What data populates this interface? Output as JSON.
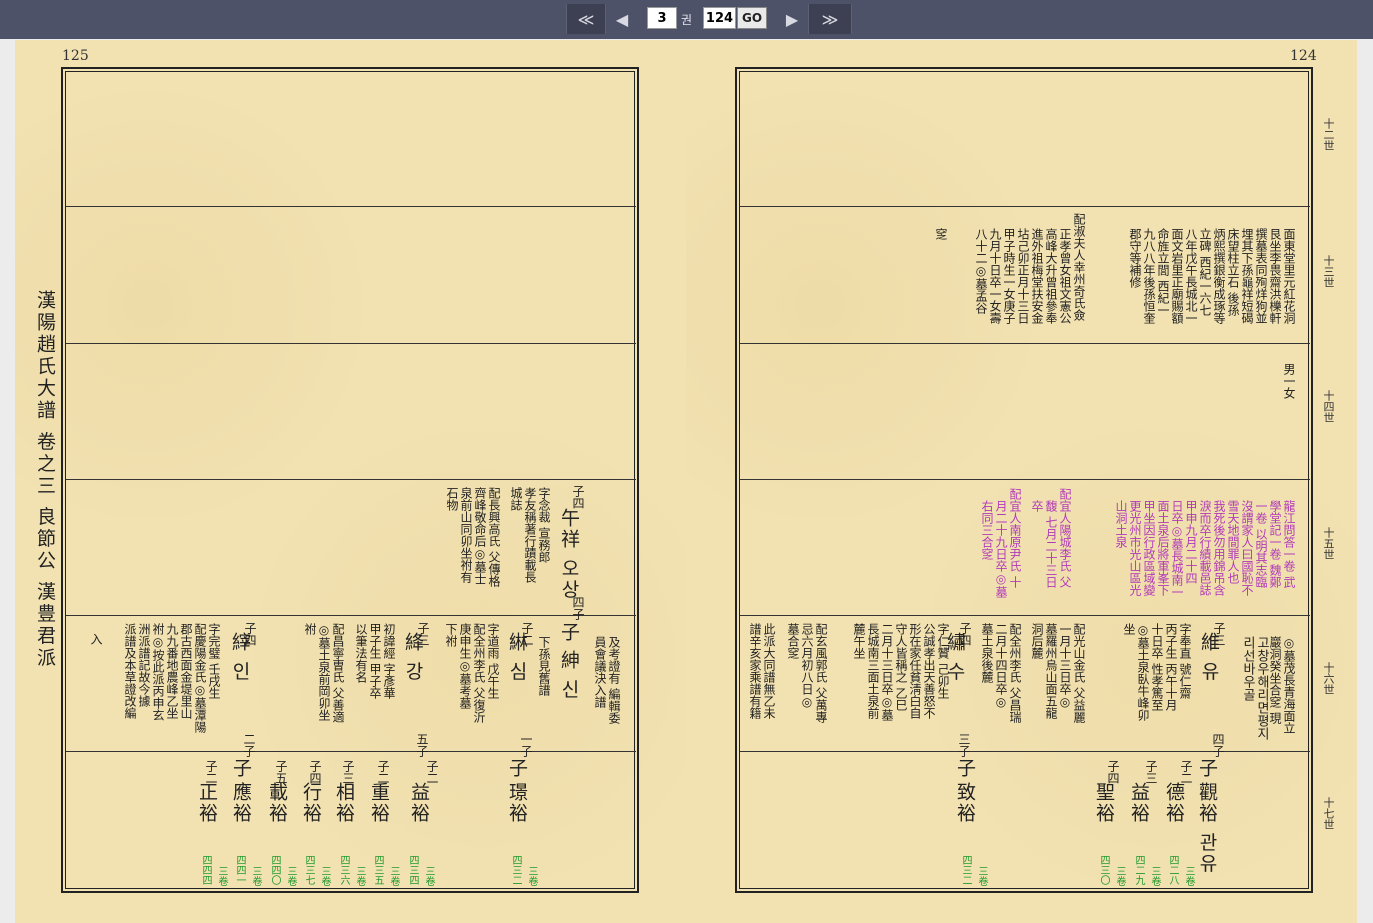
{
  "toolbar": {
    "first": "≪",
    "prev": "◀",
    "next": "▶",
    "last": "≫",
    "volume_value": "3",
    "volume_unit": "권",
    "page_value": "124",
    "go_label": "GO"
  },
  "left_page": {
    "page_number": "125",
    "side_title": "漢陽趙氏大譜 卷之三 良節公 漢豊君派",
    "cols": [
      {
        "id": "l_a1",
        "text": "子四",
        "cls": "t-sm"
      },
      {
        "id": "l_a2",
        "text": "午祥 오상",
        "cls": "t-nm"
      },
      {
        "id": "l_a3",
        "text": "四子",
        "cls": "t-sm"
      },
      {
        "id": "l_a4",
        "text": "字念裁 宣務郎",
        "cls": "t-sm"
      },
      {
        "id": "l_a5",
        "text": "孝友稱著行蹟載長",
        "cls": "t-sm"
      },
      {
        "id": "l_a6",
        "text": "城誌",
        "cls": "t-sm"
      },
      {
        "id": "l_a7",
        "text": "配長興高氏 父傳格",
        "cls": "t-sm"
      },
      {
        "id": "l_a8",
        "text": "齊峰敬命后◎墓士",
        "cls": "t-sm"
      },
      {
        "id": "l_a9",
        "text": "泉前山同卯坐祔有",
        "cls": "t-sm"
      },
      {
        "id": "l_a10",
        "text": "石物",
        "cls": "t-sm"
      },
      {
        "id": "l_b1",
        "text": "及考證有 編輯委",
        "cls": "t-sm"
      },
      {
        "id": "l_b2",
        "text": "員會議決入譜",
        "cls": "t-sm"
      },
      {
        "id": "l_b3",
        "text": "子",
        "cls": "t-nm"
      },
      {
        "id": "l_b4",
        "text": "紳 신",
        "cls": "t-nm"
      },
      {
        "id": "l_b5",
        "text": "下孫見舊譜",
        "cls": "t-sm"
      },
      {
        "id": "l_b6",
        "text": "子二",
        "cls": "t-sm"
      },
      {
        "id": "l_b7",
        "text": "綝 심",
        "cls": "t-nm"
      },
      {
        "id": "l_b8",
        "text": "一子",
        "cls": "t-sm"
      },
      {
        "id": "l_b9",
        "text": "字道雨 戊午生",
        "cls": "t-sm"
      },
      {
        "id": "l_b10",
        "text": "配全州李氏 父復沂",
        "cls": "t-sm"
      },
      {
        "id": "l_b11",
        "text": "庚申生◎墓考墓",
        "cls": "t-sm"
      },
      {
        "id": "l_b12",
        "text": "下祔",
        "cls": "t-sm"
      },
      {
        "id": "l_b13",
        "text": "子三",
        "cls": "t-sm"
      },
      {
        "id": "l_b14",
        "text": "絳 강",
        "cls": "t-nm"
      },
      {
        "id": "l_b15",
        "text": "五子",
        "cls": "t-sm"
      },
      {
        "id": "l_b16",
        "text": "初諱經 字彥華",
        "cls": "t-sm"
      },
      {
        "id": "l_b17",
        "text": "甲子生 甲子卒",
        "cls": "t-sm"
      },
      {
        "id": "l_b18",
        "text": "以筆法有名",
        "cls": "t-sm"
      },
      {
        "id": "l_b19",
        "text": "配昌寧曺氏 父善適",
        "cls": "t-sm"
      },
      {
        "id": "l_b20",
        "text": "◎墓土泉前岡卯坐",
        "cls": "t-sm"
      },
      {
        "id": "l_b21",
        "text": "祔",
        "cls": "t-sm"
      },
      {
        "id": "l_b22",
        "text": "子四",
        "cls": "t-sm"
      },
      {
        "id": "l_b23",
        "text": "縡 인",
        "cls": "t-nm"
      },
      {
        "id": "l_b24",
        "text": "二子",
        "cls": "t-sm"
      },
      {
        "id": "l_b25",
        "text": "字完璧 壬戌生",
        "cls": "t-sm"
      },
      {
        "id": "l_b26",
        "text": "配慶陽金氏◎墓潭陽",
        "cls": "t-sm"
      },
      {
        "id": "l_b27",
        "text": "郡古西面金堤里山",
        "cls": "t-sm"
      },
      {
        "id": "l_b28",
        "text": "九九番地農峰乙坐",
        "cls": "t-sm"
      },
      {
        "id": "l_b29",
        "text": "祔◎按此派丙申玄",
        "cls": "t-sm"
      },
      {
        "id": "l_b30",
        "text": "洲派譜記故今據",
        "cls": "t-sm"
      },
      {
        "id": "l_b31",
        "text": "派譜及本草證改編",
        "cls": "t-sm"
      },
      {
        "id": "l_b32",
        "text": "入",
        "cls": "t-sm"
      },
      {
        "id": "l_c1",
        "text": "子",
        "cls": "t-nm"
      },
      {
        "id": "l_c2",
        "text": "璟裕",
        "cls": "t-nm"
      },
      {
        "id": "l_c3",
        "text": "子二",
        "cls": "t-sm"
      },
      {
        "id": "l_c4",
        "text": "益裕",
        "cls": "t-nm"
      },
      {
        "id": "l_c5",
        "text": "子二",
        "cls": "t-sm"
      },
      {
        "id": "l_c6",
        "text": "重裕",
        "cls": "t-nm"
      },
      {
        "id": "l_c7",
        "text": "子三",
        "cls": "t-sm"
      },
      {
        "id": "l_c8",
        "text": "相裕",
        "cls": "t-nm"
      },
      {
        "id": "l_c9",
        "text": "子四",
        "cls": "t-sm"
      },
      {
        "id": "l_c10",
        "text": "行裕",
        "cls": "t-nm"
      },
      {
        "id": "l_c11",
        "text": "子五",
        "cls": "t-sm"
      },
      {
        "id": "l_c12",
        "text": "載裕",
        "cls": "t-nm"
      },
      {
        "id": "l_c13",
        "text": "子",
        "cls": "t-nm"
      },
      {
        "id": "l_c14",
        "text": "應裕",
        "cls": "t-nm"
      },
      {
        "id": "l_c15",
        "text": "子二",
        "cls": "t-sm"
      },
      {
        "id": "l_c16",
        "text": "正裕",
        "cls": "t-nm"
      },
      {
        "id": "l_g1",
        "text": "三卷",
        "cls": "t-gr"
      },
      {
        "id": "l_g2",
        "text": "四三二",
        "cls": "t-gr"
      },
      {
        "id": "l_g3",
        "text": "三卷",
        "cls": "t-gr"
      },
      {
        "id": "l_g4",
        "text": "四三四",
        "cls": "t-gr"
      },
      {
        "id": "l_g5",
        "text": "三卷",
        "cls": "t-gr"
      },
      {
        "id": "l_g6",
        "text": "四三五",
        "cls": "t-gr"
      },
      {
        "id": "l_g7",
        "text": "三卷",
        "cls": "t-gr"
      },
      {
        "id": "l_g8",
        "text": "四三六",
        "cls": "t-gr"
      },
      {
        "id": "l_g9",
        "text": "三卷",
        "cls": "t-gr"
      },
      {
        "id": "l_g10",
        "text": "四三七",
        "cls": "t-gr"
      },
      {
        "id": "l_g11",
        "text": "三卷",
        "cls": "t-gr"
      },
      {
        "id": "l_g12",
        "text": "四四〇",
        "cls": "t-gr"
      },
      {
        "id": "l_g13",
        "text": "三卷",
        "cls": "t-gr"
      },
      {
        "id": "l_g14",
        "text": "四四一",
        "cls": "t-gr"
      },
      {
        "id": "l_g15",
        "text": "三卷",
        "cls": "t-gr"
      },
      {
        "id": "l_g16",
        "text": "四四四",
        "cls": "t-gr"
      }
    ]
  },
  "right_page": {
    "page_number": "124",
    "generations": [
      "十二世",
      "十三世",
      "十四世",
      "十五世",
      "十六世",
      "十七世"
    ],
    "cols": [
      {
        "id": "r_a1",
        "text": "面東堂里元紅花洞",
        "cls": "t-sm"
      },
      {
        "id": "r_a2",
        "text": "艮坐李畏齋洪櫟軒",
        "cls": "t-sm"
      },
      {
        "id": "r_a3",
        "text": "撰墓表同殉烊狗並",
        "cls": "t-sm"
      },
      {
        "id": "r_a4",
        "text": "埋其下孫龜祥短碣",
        "cls": "t-sm"
      },
      {
        "id": "r_a5",
        "text": "床望柱立石 後孫",
        "cls": "t-sm"
      },
      {
        "id": "r_a6",
        "text": "炳熙撰銀衡成琢等",
        "cls": "t-sm"
      },
      {
        "id": "r_a7",
        "text": "立碑 西紀一六七",
        "cls": "t-sm"
      },
      {
        "id": "r_a8",
        "text": "八年戊午長城北一",
        "cls": "t-sm"
      },
      {
        "id": "r_a9",
        "text": "面文岩里正廟賜額",
        "cls": "t-sm"
      },
      {
        "id": "r_a10",
        "text": "命旌立閭 西紀一",
        "cls": "t-sm"
      },
      {
        "id": "r_a11",
        "text": "九八八年後孫恒奎",
        "cls": "t-sm"
      },
      {
        "id": "r_a12",
        "text": "郡守等補修",
        "cls": "t-sm"
      },
      {
        "id": "r_a13",
        "text": "配淑夫人幸州奇氏僉",
        "cls": "t-sm"
      },
      {
        "id": "r_a14",
        "text": "正孝曾女祖文憲公",
        "cls": "t-sm"
      },
      {
        "id": "r_a15",
        "text": "高峰大升曾祖參奉",
        "cls": "t-sm"
      },
      {
        "id": "r_a16",
        "text": "進外祖梅堂扶安金",
        "cls": "t-sm"
      },
      {
        "id": "r_a17",
        "text": "坫己卯正月十三日",
        "cls": "t-sm"
      },
      {
        "id": "r_a18",
        "text": "甲子時生一女庚子",
        "cls": "t-sm"
      },
      {
        "id": "r_a19",
        "text": "九月十日卒一女壽",
        "cls": "t-sm"
      },
      {
        "id": "r_a20",
        "text": "八十二◎墓孟谷",
        "cls": "t-sm"
      },
      {
        "id": "r_a21",
        "text": "窆",
        "cls": "t-sm"
      },
      {
        "id": "r_b1",
        "text": "男一女",
        "cls": "t-sm"
      },
      {
        "id": "r_c1",
        "text": "龍江問答一卷 武",
        "cls": "t-pk"
      },
      {
        "id": "r_c2",
        "text": "學堂記一卷 魏鄭",
        "cls": "t-pk"
      },
      {
        "id": "r_c3",
        "text": "一卷 以明其志臨",
        "cls": "t-pk"
      },
      {
        "id": "r_c4",
        "text": "沒謂家人曰國恥不",
        "cls": "t-pk"
      },
      {
        "id": "r_c5",
        "text": "雪天地間罪人也",
        "cls": "t-pk"
      },
      {
        "id": "r_c6",
        "text": "我死後勿用錦吊含",
        "cls": "t-pk"
      },
      {
        "id": "r_c7",
        "text": "淚而卒行績載邑誌",
        "cls": "t-pk"
      },
      {
        "id": "r_c8",
        "text": "甲申九月二十四",
        "cls": "t-pk"
      },
      {
        "id": "r_c9",
        "text": "日卒◎墓長城南一",
        "cls": "t-pk"
      },
      {
        "id": "r_c10",
        "text": "面土泉后將軍峯下",
        "cls": "t-pk"
      },
      {
        "id": "r_c11",
        "text": "甲坐因行政區域變",
        "cls": "t-pk"
      },
      {
        "id": "r_c12",
        "text": "更光州市光山區光",
        "cls": "t-pk"
      },
      {
        "id": "r_c13",
        "text": "山洞土泉",
        "cls": "t-pk"
      },
      {
        "id": "r_c14",
        "text": "配宜人陽城李氏 父",
        "cls": "t-pk"
      },
      {
        "id": "r_c15",
        "text": "馥 七月二十三日",
        "cls": "t-pk"
      },
      {
        "id": "r_c16",
        "text": "卒",
        "cls": "t-pk"
      },
      {
        "id": "r_c17",
        "text": "配宜人南原尹氏 十",
        "cls": "t-pk"
      },
      {
        "id": "r_c18",
        "text": "月二十九日卒◎墓",
        "cls": "t-pk"
      },
      {
        "id": "r_c19",
        "text": "右同三合窆",
        "cls": "t-pk"
      },
      {
        "id": "r_d1",
        "text": "◎墓茂長青海面立",
        "cls": "t-sm"
      },
      {
        "id": "r_d2",
        "text": "巖洞癸坐合窆 現",
        "cls": "t-sm"
      },
      {
        "id": "r_d3",
        "text": "고창우해리면평지",
        "cls": "t-ko"
      },
      {
        "id": "r_d4",
        "text": "리선바우골",
        "cls": "t-ko"
      },
      {
        "id": "r_d5",
        "text": "子三",
        "cls": "t-sm"
      },
      {
        "id": "r_d6",
        "text": "維 유",
        "cls": "t-nm"
      },
      {
        "id": "r_d7",
        "text": "四子",
        "cls": "t-sm"
      },
      {
        "id": "r_d8",
        "text": "字奉直 號仁齋",
        "cls": "t-sm"
      },
      {
        "id": "r_d9",
        "text": "丙子生 丙午十月",
        "cls": "t-sm"
      },
      {
        "id": "r_d10",
        "text": "十日卒 性孝篤至",
        "cls": "t-sm"
      },
      {
        "id": "r_d11",
        "text": "◎墓土泉臥牛峰卯",
        "cls": "t-sm"
      },
      {
        "id": "r_d12",
        "text": "坐",
        "cls": "t-sm"
      },
      {
        "id": "r_d13",
        "text": "配光山金氏 父益麗",
        "cls": "t-sm"
      },
      {
        "id": "r_d14",
        "text": "一月十三日卒◎",
        "cls": "t-sm"
      },
      {
        "id": "r_d15",
        "text": "墓羅州烏山面五龍",
        "cls": "t-sm"
      },
      {
        "id": "r_d16",
        "text": "洞后麓",
        "cls": "t-sm"
      },
      {
        "id": "r_d17",
        "text": "配全州李氏 父昌瑞",
        "cls": "t-sm"
      },
      {
        "id": "r_d18",
        "text": "二月十四日卒◎",
        "cls": "t-sm"
      },
      {
        "id": "r_d19",
        "text": "墓土泉後麓",
        "cls": "t-sm"
      },
      {
        "id": "r_d20",
        "text": "子四",
        "cls": "t-sm"
      },
      {
        "id": "r_d21",
        "text": "繡 수",
        "cls": "t-nm"
      },
      {
        "id": "r_d22",
        "text": "三子",
        "cls": "t-sm"
      },
      {
        "id": "r_d23",
        "text": "字仁贊 己卯生",
        "cls": "t-sm"
      },
      {
        "id": "r_d24",
        "text": "公誠孝出天善怒不",
        "cls": "t-sm"
      },
      {
        "id": "r_d25",
        "text": "形在家任貧淸白自",
        "cls": "t-sm"
      },
      {
        "id": "r_d26",
        "text": "守人皆稱之 乙巳",
        "cls": "t-sm"
      },
      {
        "id": "r_d27",
        "text": "二月十三日卒◎墓",
        "cls": "t-sm"
      },
      {
        "id": "r_d28",
        "text": "長城南三面土泉前",
        "cls": "t-sm"
      },
      {
        "id": "r_d29",
        "text": "麓午坐",
        "cls": "t-sm"
      },
      {
        "id": "r_d30",
        "text": "配玄風郭氏 父萬專",
        "cls": "t-sm"
      },
      {
        "id": "r_d31",
        "text": "忌六月初八日◎",
        "cls": "t-sm"
      },
      {
        "id": "r_d32",
        "text": "墓合窆",
        "cls": "t-sm"
      },
      {
        "id": "r_d33",
        "text": "此派大同譜無乙未",
        "cls": "t-sm"
      },
      {
        "id": "r_d34",
        "text": "譜辛亥家乘譜有籍",
        "cls": "t-sm"
      },
      {
        "id": "r_e1",
        "text": "子",
        "cls": "t-nm"
      },
      {
        "id": "r_e2",
        "text": "觀裕 관유",
        "cls": "t-nm"
      },
      {
        "id": "r_e3",
        "text": "子二",
        "cls": "t-sm"
      },
      {
        "id": "r_e4",
        "text": "德裕",
        "cls": "t-nm"
      },
      {
        "id": "r_e5",
        "text": "子三",
        "cls": "t-sm"
      },
      {
        "id": "r_e6",
        "text": "益裕",
        "cls": "t-nm"
      },
      {
        "id": "r_e7",
        "text": "子四",
        "cls": "t-sm"
      },
      {
        "id": "r_e8",
        "text": "聖裕",
        "cls": "t-nm"
      },
      {
        "id": "r_e9",
        "text": "子",
        "cls": "t-nm"
      },
      {
        "id": "r_e10",
        "text": "致裕",
        "cls": "t-nm"
      },
      {
        "id": "r_g1",
        "text": "三卷",
        "cls": "t-gr"
      },
      {
        "id": "r_g2",
        "text": "四二八",
        "cls": "t-gr"
      },
      {
        "id": "r_g3",
        "text": "三卷",
        "cls": "t-gr"
      },
      {
        "id": "r_g4",
        "text": "四二九",
        "cls": "t-gr"
      },
      {
        "id": "r_g5",
        "text": "三卷",
        "cls": "t-gr"
      },
      {
        "id": "r_g6",
        "text": "四三〇",
        "cls": "t-gr"
      },
      {
        "id": "r_g7",
        "text": "三卷",
        "cls": "t-gr"
      },
      {
        "id": "r_g8",
        "text": "四三二",
        "cls": "t-gr"
      }
    ]
  }
}
